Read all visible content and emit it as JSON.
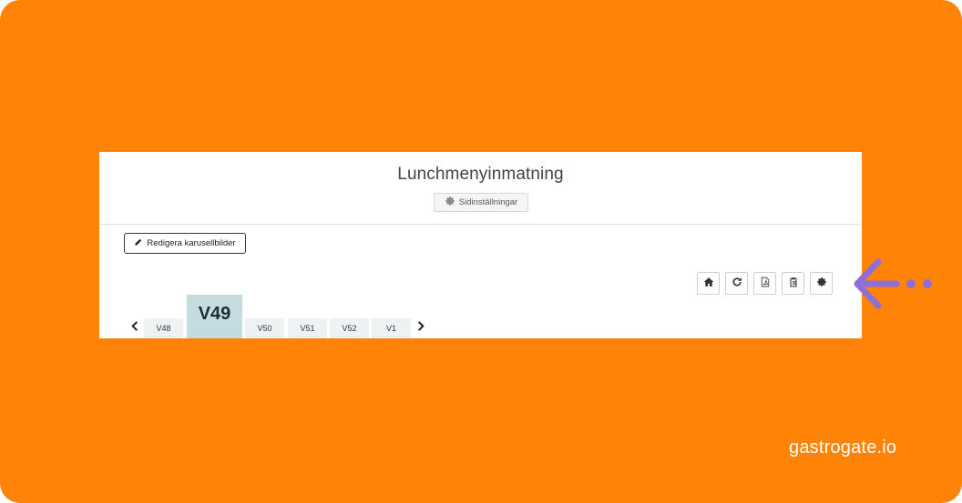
{
  "page": {
    "title": "Lunchmenyinmatning",
    "settings_label": "Sidinställningar",
    "edit_carousel_label": "Redigera karusellbilder"
  },
  "toolbar": {
    "buttons": [
      {
        "icon": "home-icon"
      },
      {
        "icon": "refresh-icon"
      },
      {
        "icon": "pdf-icon"
      },
      {
        "icon": "clipboard-icon"
      },
      {
        "icon": "gear-icon"
      }
    ]
  },
  "weeks": {
    "tabs": [
      "V48",
      "V49",
      "V50",
      "V51",
      "V52",
      "V1"
    ],
    "active": "V49"
  },
  "brand": "gastrogate.io",
  "colors": {
    "background": "#ff8307",
    "active_tab": "#c4dbdf",
    "inactive_tab": "#eef2f3",
    "annotation_arrow": "#8f6fd6"
  }
}
